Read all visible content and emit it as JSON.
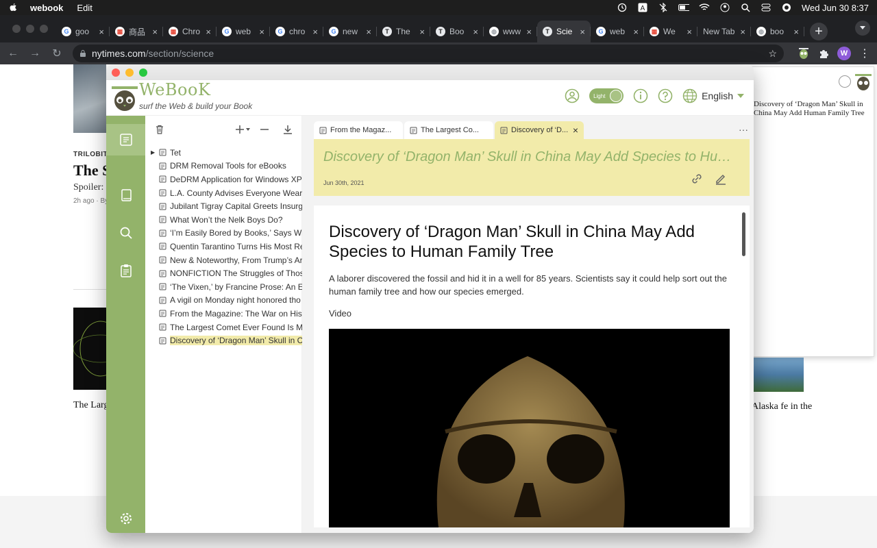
{
  "menubar": {
    "app_name": "webook",
    "edit_menu": "Edit",
    "clock": "Wed Jun 30  8:37"
  },
  "browser": {
    "tabs": [
      {
        "label": "goo",
        "favicon": "google-icon",
        "color": "#4285f4"
      },
      {
        "label": "商品",
        "favicon": "store-icon",
        "color": "#e74c3c"
      },
      {
        "label": "Chro",
        "favicon": "store-icon",
        "color": "#e74c3c"
      },
      {
        "label": "web",
        "favicon": "google-icon",
        "color": "#4285f4"
      },
      {
        "label": "chro",
        "favicon": "google-icon",
        "color": "#4285f4"
      },
      {
        "label": "new",
        "favicon": "google-icon",
        "color": "#4285f4"
      },
      {
        "label": "The",
        "favicon": "nyt-icon",
        "color": "#222222"
      },
      {
        "label": "Boo",
        "favicon": "nyt-icon",
        "color": "#222222"
      },
      {
        "label": "www",
        "favicon": "globe-icon",
        "color": "#9aa0a6"
      },
      {
        "label": "Scie",
        "favicon": "nyt-icon",
        "color": "#222222",
        "active": true
      },
      {
        "label": "web",
        "favicon": "google-icon",
        "color": "#4285f4"
      },
      {
        "label": "We",
        "favicon": "store-icon",
        "color": "#e74c3c"
      },
      {
        "label": "New Tab",
        "favicon": "",
        "color": ""
      },
      {
        "label": "boo",
        "favicon": "globe-icon",
        "color": "#9aa0a6"
      }
    ],
    "url_host": "nytimes.com",
    "url_path": "/section/science",
    "profile_initial": "W"
  },
  "nyt": {
    "kicker": "TRILOBITE",
    "headline1": "The S",
    "summary1": "Spoiler:",
    "meta1": "2h ago · By",
    "headline2": "The Larg Is Makin Near You",
    "headline3": "Alaska fe in the"
  },
  "sidepanel": {
    "title": "Discovery of ‘Dragon Man’ Skull in China May Add Human Family Tree"
  },
  "webook": {
    "logo_text": "WeBooK",
    "tagline": "surf the Web & build your Book",
    "theme_toggle": "Light",
    "language": "English",
    "tree": [
      {
        "label": "Tet",
        "has_children": true
      },
      {
        "label": "DRM Removal Tools for eBooks"
      },
      {
        "label": "DeDRM Application for Windows XP"
      },
      {
        "label": "L.A. County Advises Everyone Wear"
      },
      {
        "label": "Jubilant Tigray Capital Greets Insurg"
      },
      {
        "label": "What Won’t the Nelk Boys Do?"
      },
      {
        "label": "‘I’m Easily Bored by Books,’ Says Wr"
      },
      {
        "label": "Quentin Tarantino Turns His Most Re"
      },
      {
        "label": "New & Noteworthy, From Trump’s Ar"
      },
      {
        "label": "NONFICTION The Struggles of Thos"
      },
      {
        "label": "‘The Vixen,’ by Francine Prose: An Ex"
      },
      {
        "label": "A vigil on Monday night honored tho"
      },
      {
        "label": "From the Magazine: The War on Hist"
      },
      {
        "label": "The Largest Comet Ever Found Is Ma"
      },
      {
        "label": "Discovery of ‘Dragon Man’ Skull in C",
        "selected": true
      }
    ],
    "tabs": [
      {
        "label": "From the Magaz..."
      },
      {
        "label": "The Largest Co..."
      },
      {
        "label": "Discovery of ‘D...",
        "active": true
      }
    ],
    "banner": {
      "title": "Discovery of ‘Dragon Man’ Skull in China May Add Species to Human Family Tree",
      "date": "Jun 30th, 2021"
    },
    "article": {
      "headline": "Discovery of ‘Dragon Man’ Skull in China May Add Species to Human Family Tree",
      "lede": "A laborer discovered the fossil and hid it in a well for 85 years. Scientists say it could help sort out the human family tree and how our species emerged.",
      "video_label": "Video"
    },
    "accent_color": "#93b36a",
    "highlight_color": "#f2ebaa"
  }
}
